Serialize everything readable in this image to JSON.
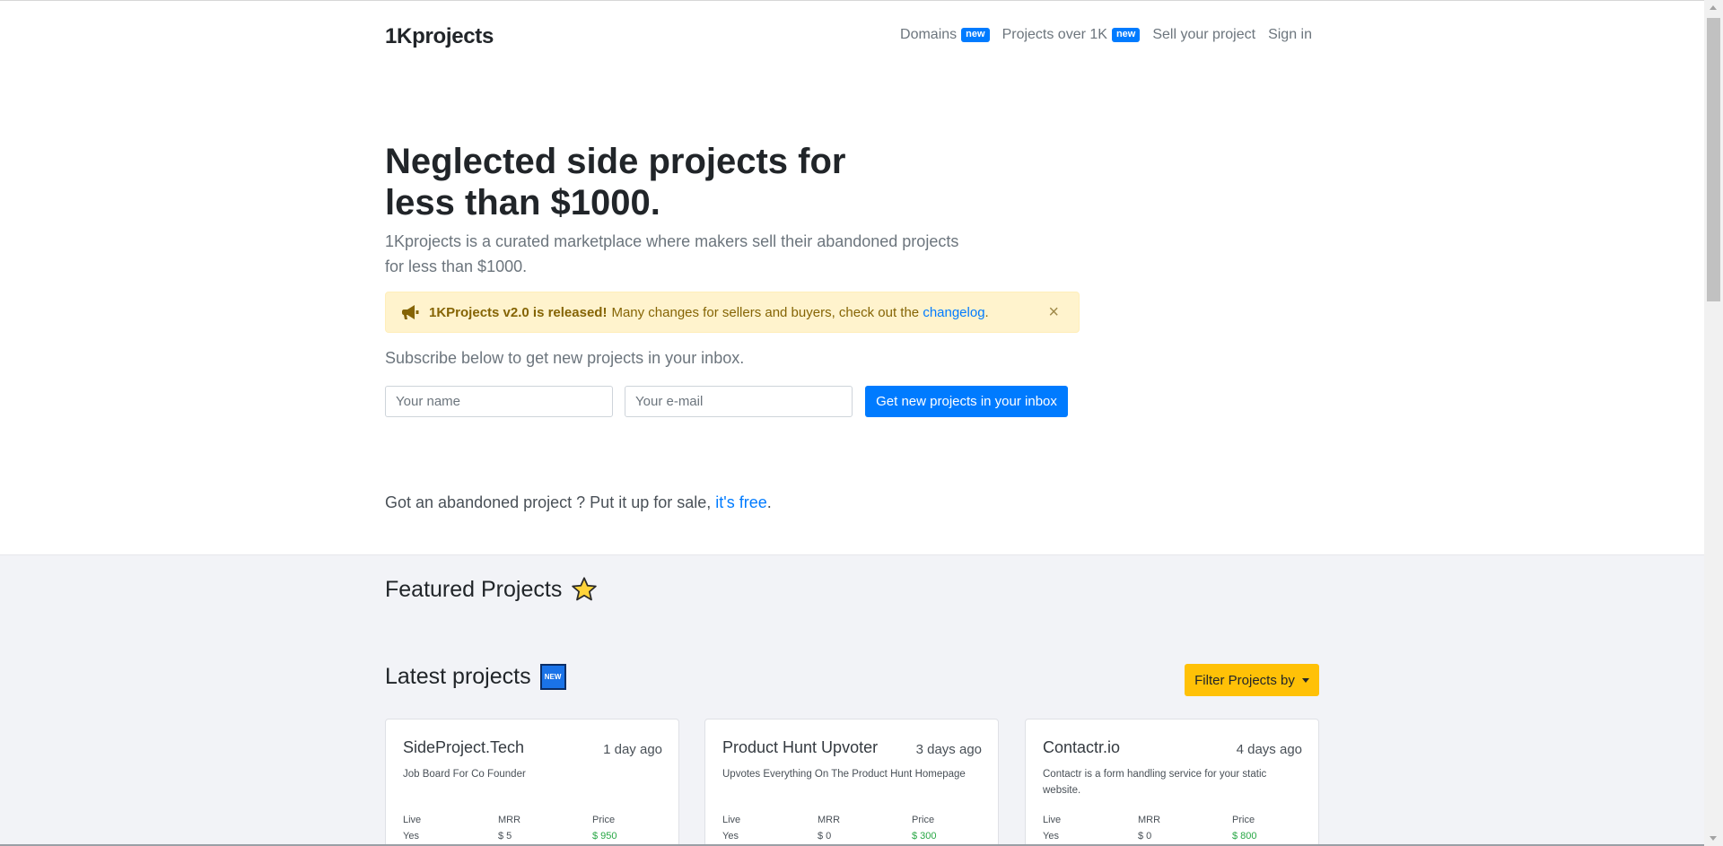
{
  "nav": {
    "brand": "1Kprojects",
    "items": [
      {
        "label": "Domains",
        "badge": "new"
      },
      {
        "label": "Projects over 1K",
        "badge": "new"
      },
      {
        "label": "Sell your project"
      },
      {
        "label": "Sign in"
      }
    ]
  },
  "hero": {
    "title": "Neglected side projects for less than $1000.",
    "lead": "1Kprojects is a curated marketplace where makers sell their abandoned projects for less than $1000."
  },
  "alert": {
    "bold": "1KProjects v2.0 is released!",
    "text": "Many changes for sellers and buyers, check out the",
    "link": "changelog",
    "suffix": ".",
    "close": "×"
  },
  "subscribe": {
    "text": "Subscribe below to get new projects in your inbox.",
    "name_placeholder": "Your name",
    "email_placeholder": "Your e-mail",
    "button": "Get new projects in your inbox"
  },
  "sell": {
    "text": "Got an abandoned project ? Put it up for sale,",
    "link": "it's free",
    "suffix": "."
  },
  "featured": {
    "title": "Featured Projects"
  },
  "latest": {
    "title": "Latest projects",
    "badge": "NEW",
    "filter_button": "Filter Projects by"
  },
  "stat_labels": {
    "live": "Live",
    "mrr": "MRR",
    "price": "Price"
  },
  "projects": [
    {
      "name": "SideProject.Tech",
      "date": "1 day ago",
      "desc": "Job Board For Co Founder",
      "live": "Yes",
      "mrr": "$ 5",
      "price": "$ 950"
    },
    {
      "name": "Product Hunt Upvoter",
      "date": "3 days ago",
      "desc": "Upvotes Everything On The Product Hunt Homepage",
      "live": "Yes",
      "mrr": "$ 0",
      "price": "$ 300"
    },
    {
      "name": "Contactr.io",
      "date": "4 days ago",
      "desc": "Contactr is a form handling service for your static website.",
      "live": "Yes",
      "mrr": "$ 0",
      "price": "$ 800"
    }
  ],
  "colors": {
    "primary": "#007bff",
    "warning": "#ffc107",
    "alert_bg": "#fff3cd",
    "price_green": "#28a745",
    "page_bg": "#f2f3f7"
  },
  "icons": {
    "megaphone": "megaphone-icon",
    "star": "star-icon",
    "close": "close-icon"
  }
}
